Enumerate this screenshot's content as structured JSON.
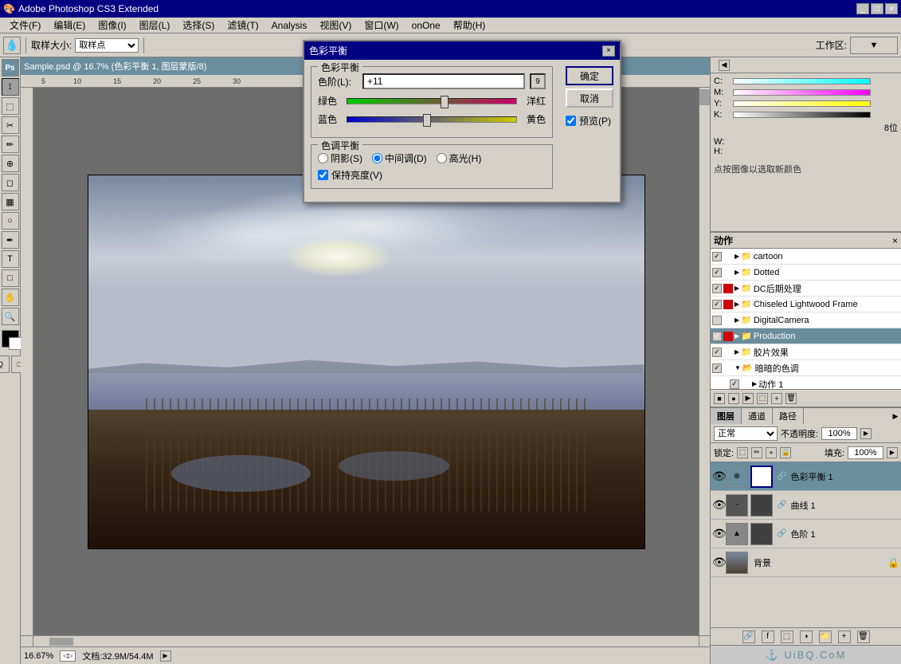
{
  "titleBar": {
    "title": "Adobe Photoshop CS3 Extended",
    "btns": [
      "_",
      "□",
      "×"
    ]
  },
  "menuBar": {
    "items": [
      "文件(F)",
      "编辑(E)",
      "图像(I)",
      "图层(L)",
      "选择(S)",
      "滤镜(T)",
      "Analysis",
      "视图(V)",
      "窗口(W)",
      "onOne",
      "帮助(H)"
    ]
  },
  "toolbar": {
    "sampleLabel": "取样大小:",
    "sampleInput": "取样点",
    "toolbarLabel": "工作区:"
  },
  "document": {
    "title": "Sample.psd @ 16.7% (色彩平衡 1, 图层蒙版/8)",
    "zoom": "16.67%",
    "docInfo": "文档:32.9M/54.4M"
  },
  "colorBalance": {
    "dialogTitle": "色彩平衡",
    "groupLabel": "色彩平衡",
    "colorLevelLabel": "色阶(L):",
    "colorLevelValue": "+11",
    "greenLabel": "绿色",
    "redLabel": "洋红",
    "blueLabel": "蓝色",
    "yellowLabel": "黄色",
    "toneGroupLabel": "色调平衡",
    "shadowLabel": "阴影(S)",
    "midtoneLabel": "中间调(D)",
    "highlightLabel": "高光(H)",
    "preserveLumLabel": "保持亮度(V)",
    "okBtn": "确定",
    "cancelBtn": "取消",
    "previewLabel": "预览(P)",
    "sliderGreenPos": 55,
    "sliderBluePos": 45,
    "selectedTone": "midtone"
  },
  "colorPanel": {
    "clickInfo": "点按图像以选取新颜色",
    "cmyk": {
      "c": {
        "label": "C:",
        "value": ""
      },
      "m": {
        "label": "M:",
        "value": ""
      },
      "y": {
        "label": "Y:",
        "value": ""
      },
      "k": {
        "label": "K:",
        "value": ""
      },
      "bits": "8位"
    },
    "wLabel": "W:",
    "hLabel": "H:"
  },
  "actionsPanel": {
    "title": "动作",
    "closeBtn": "×",
    "actions": [
      {
        "id": 1,
        "checked": true,
        "redMark": false,
        "hasSubArrow": true,
        "name": "cartoon",
        "expanded": false
      },
      {
        "id": 2,
        "checked": true,
        "redMark": false,
        "hasSubArrow": true,
        "name": "Dotted",
        "expanded": false
      },
      {
        "id": 3,
        "checked": true,
        "redMark": true,
        "hasSubArrow": true,
        "name": "DC后期处理",
        "expanded": false
      },
      {
        "id": 4,
        "checked": true,
        "redMark": true,
        "hasSubArrow": true,
        "name": "Chiseled Lightwood Frame",
        "expanded": false
      },
      {
        "id": 5,
        "checked": false,
        "redMark": false,
        "hasSubArrow": true,
        "name": "DigitalCamera",
        "expanded": false
      },
      {
        "id": 6,
        "checked": true,
        "redMark": true,
        "hasSubArrow": true,
        "name": "Production",
        "expanded": false
      },
      {
        "id": 7,
        "checked": true,
        "redMark": false,
        "hasSubArrow": true,
        "name": "胶片效果",
        "expanded": false
      },
      {
        "id": 8,
        "checked": true,
        "redMark": false,
        "hasSubArrow": true,
        "name": "暗暗的色调",
        "expanded": true
      },
      {
        "id": 9,
        "checked": true,
        "redMark": false,
        "hasSubArrow": true,
        "name": "动作 1",
        "expanded": false,
        "isChild": true
      }
    ],
    "toolbarBtns": [
      "■",
      "●",
      "▶",
      "■■",
      "＋",
      "🗑"
    ]
  },
  "layersPanel": {
    "tabs": [
      "图层",
      "通道",
      "路径"
    ],
    "activeTab": "图层",
    "blendMode": "正常",
    "opacity": "100%",
    "lockLabel": "锁定:",
    "fillLabel": "填充:",
    "fillValue": "100%",
    "layers": [
      {
        "id": 1,
        "name": "色彩平衡 1",
        "type": "adjustment",
        "selected": true,
        "visible": true,
        "hasMask": true
      },
      {
        "id": 2,
        "name": "曲线 1",
        "type": "adjustment",
        "selected": false,
        "visible": true,
        "hasMask": true
      },
      {
        "id": 3,
        "name": "色阶 1",
        "type": "adjustment",
        "selected": false,
        "visible": true,
        "hasMask": true
      },
      {
        "id": 4,
        "name": "背景",
        "type": "image",
        "selected": false,
        "visible": true,
        "hasMask": false,
        "locked": true
      }
    ]
  }
}
